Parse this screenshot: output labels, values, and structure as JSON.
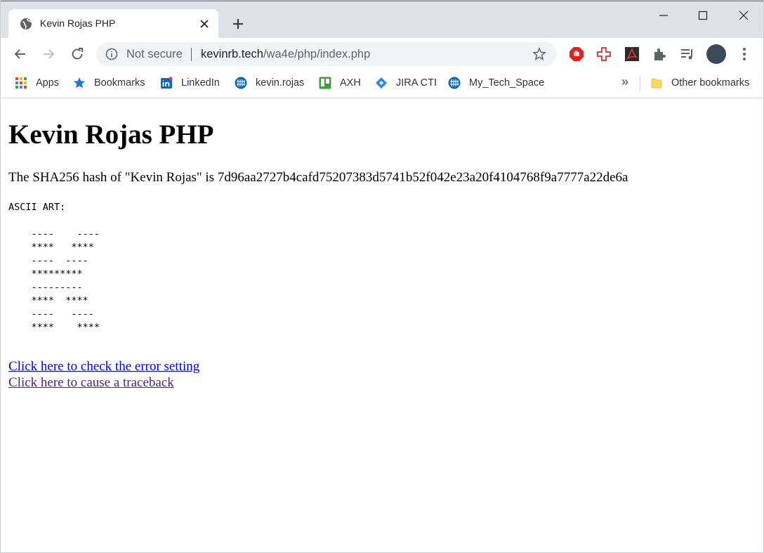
{
  "browser": {
    "tab": {
      "title": "Kevin Rojas PHP"
    },
    "omnibox": {
      "security_label": "Not secure",
      "url_host": "kevinrb.tech",
      "url_path": "/wa4e/php/index.php"
    },
    "bookmarks": [
      {
        "label": "Apps",
        "icon": "apps-grid-icon"
      },
      {
        "label": "Bookmarks",
        "icon": "star-icon"
      },
      {
        "label": "LinkedIn",
        "icon": "linkedin-icon"
      },
      {
        "label": "kevin.rojas",
        "icon": "upc-globe-icon"
      },
      {
        "label": "AXH",
        "icon": "trello-icon"
      },
      {
        "label": "JIRA CTI",
        "icon": "jira-icon"
      },
      {
        "label": "My_Tech_Space",
        "icon": "upc-globe-icon"
      }
    ],
    "other_bookmarks": "Other bookmarks",
    "colors": {
      "accent": "#1a73e8",
      "tabstrip": "#dee1e6"
    }
  },
  "page": {
    "heading": "Kevin Rojas PHP",
    "hash_text": "The SHA256 hash of \"Kevin Rojas\" is 7d96aa2727b4cafd75207383d5741b52f042e23a20f4104768f9a7777a22de6a",
    "ascii_label": "ASCII ART:",
    "ascii_art": "    ----    ----\n    ****   ****\n    ----  ----\n    *********\n    ---------\n    ****  ****\n    ----   ----\n    ****    ****",
    "links": [
      {
        "text": "Click here to check the error setting"
      },
      {
        "text": "Click here to cause a traceback"
      }
    ]
  }
}
